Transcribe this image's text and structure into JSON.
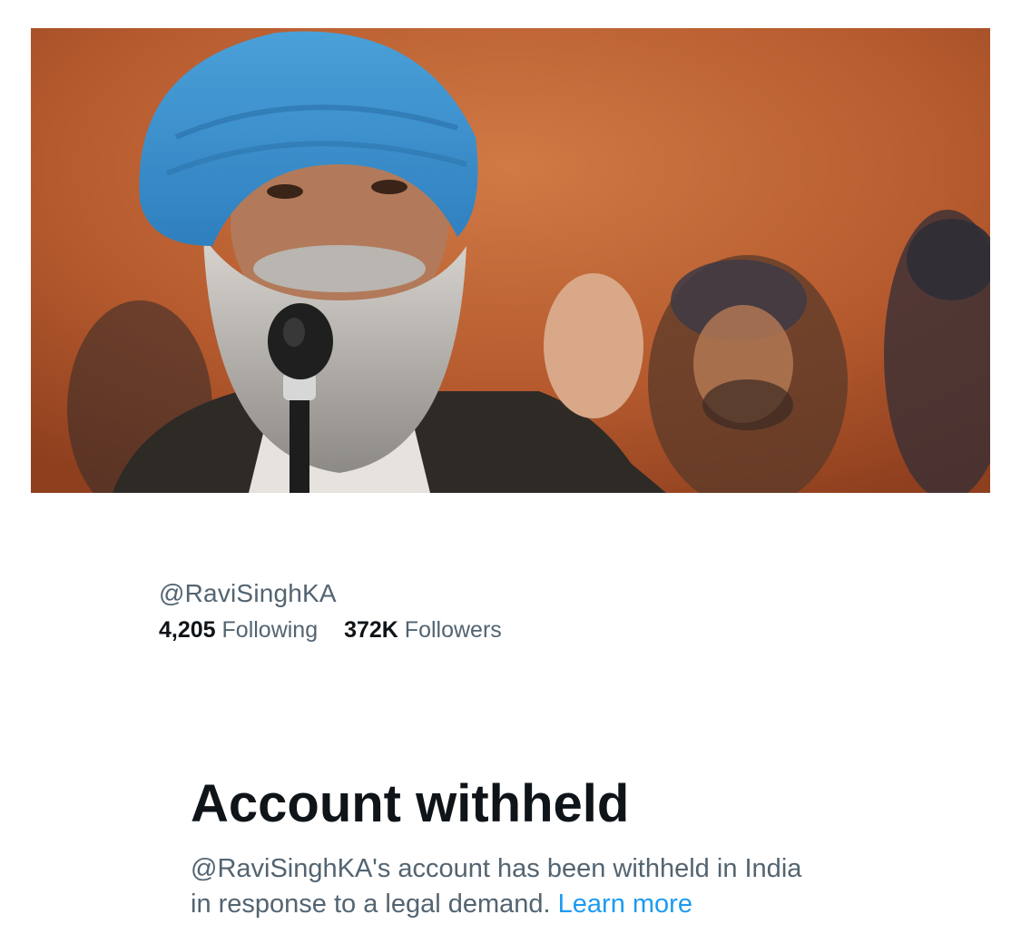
{
  "banner": {
    "image": "profile-banner-photo"
  },
  "profile": {
    "handle": "@RaviSinghKA",
    "following_count": "4,205",
    "following_label": "Following",
    "followers_count": "372K",
    "followers_label": "Followers"
  },
  "withheld": {
    "title": "Account withheld",
    "body": "@RaviSinghKA's account has been withheld in India in response to a legal demand.",
    "learn_more": "Learn more"
  },
  "colors": {
    "text_primary": "#0f1419",
    "text_secondary": "#536471",
    "link": "#1d9bf0"
  }
}
